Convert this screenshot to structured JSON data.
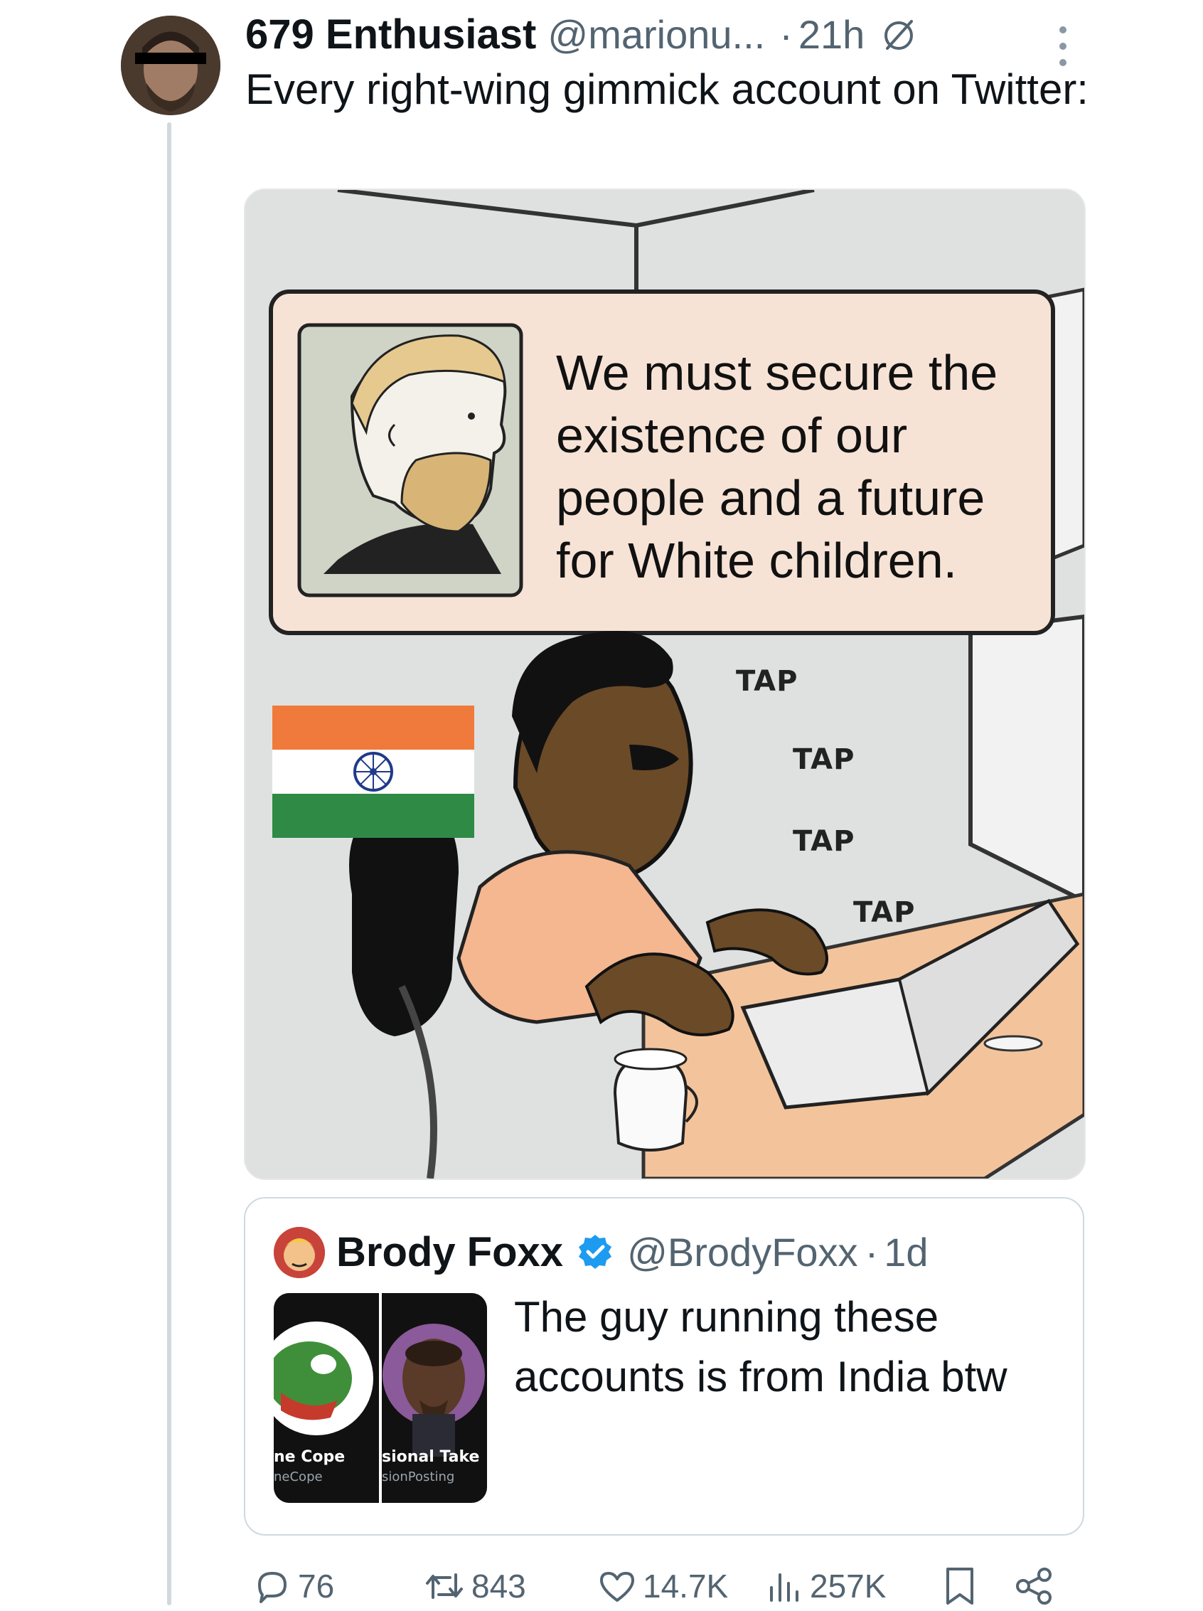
{
  "tweet": {
    "author_name": "679 Enthusiast",
    "author_handle": "@marionu...",
    "dot": "·",
    "time": "21h",
    "text": "Every right-wing gimmick account on Twitter:",
    "image": {
      "caption": "We must secure the existence of our people and a future for White children.",
      "sound_effects": [
        "TAP",
        "TAP",
        "TAP",
        "TAP"
      ]
    }
  },
  "quote": {
    "author_name": "Brody Foxx",
    "author_handle": "@BrodyFoxx",
    "dot": "·",
    "time": "1d",
    "text": "The guy running these accounts is from India btw",
    "image": {
      "left_name": "ne Cope",
      "left_handle": "neCope",
      "right_name": "sional Take",
      "right_handle": "sionPosting"
    }
  },
  "actions": {
    "replies": "76",
    "reposts": "843",
    "likes": "14.7K",
    "views": "257K"
  },
  "colors": {
    "text_primary": "#0f1419",
    "text_secondary": "#536471",
    "verified": "#1d9bf0",
    "border": "#cfd9de",
    "flag_saffron": "#f07a3b",
    "flag_green": "#2f8a45",
    "flag_chakra": "#1f3a8a"
  },
  "icons": [
    "edit-history-icon",
    "more-icon",
    "verified-icon",
    "reply-icon",
    "repost-icon",
    "like-icon",
    "views-icon",
    "bookmark-icon",
    "share-icon"
  ]
}
